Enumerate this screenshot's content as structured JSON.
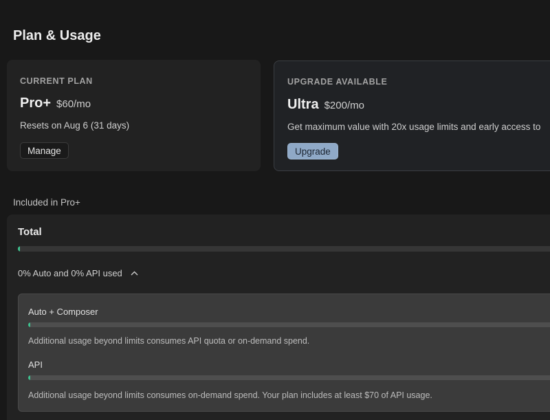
{
  "page": {
    "title": "Plan & Usage"
  },
  "current_plan": {
    "eyebrow": "CURRENT PLAN",
    "name": "Pro+",
    "price": "$60/mo",
    "reset_text": "Resets on Aug 6 (31 days)",
    "manage_label": "Manage"
  },
  "upgrade": {
    "eyebrow": "UPGRADE AVAILABLE",
    "name": "Ultra",
    "price": "$200/mo",
    "description": "Get maximum value with 20x usage limits and early access to",
    "button_label": "Upgrade"
  },
  "included": {
    "label": "Included in Pro+",
    "total_label": "Total",
    "total_progress": 0,
    "breakdown_label": "0% Auto and 0% API used",
    "breakdown_expanded": true,
    "items": [
      {
        "title": "Auto + Composer",
        "progress": 0,
        "note": "Additional usage beyond limits consumes API quota or on-demand spend."
      },
      {
        "title": "API",
        "progress": 0,
        "note": "Additional usage beyond limits consumes on-demand spend. Your plan includes at least $70 of API usage."
      }
    ]
  },
  "colors": {
    "accent": "#3ec28f",
    "upgrade_button": "#8fa9c7",
    "background": "#181818"
  },
  "icons": {
    "toggle": "chevron-up-icon"
  }
}
